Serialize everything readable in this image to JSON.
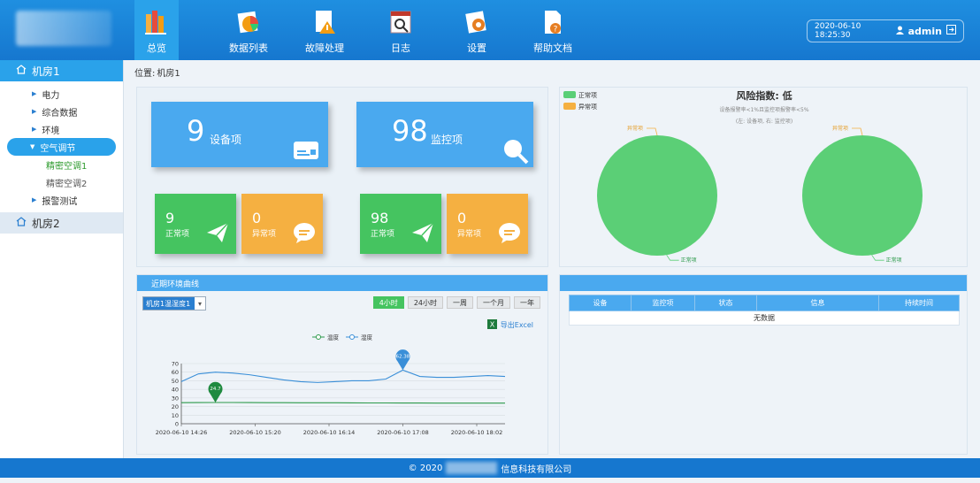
{
  "nav": [
    {
      "label": "总览",
      "icon": "books-icon",
      "active": true
    },
    {
      "label": "数据列表",
      "icon": "pie-chart-icon"
    },
    {
      "label": "故障处理",
      "icon": "warning-icon"
    },
    {
      "label": "日志",
      "icon": "calendar-search-icon"
    },
    {
      "label": "设置",
      "icon": "gear-icon"
    },
    {
      "label": "帮助文档",
      "icon": "help-document-icon"
    }
  ],
  "header": {
    "datetime": "2020-06-10  18:25:30",
    "user": "admin"
  },
  "sidebar": {
    "room1": "机房1",
    "items": [
      "电力",
      "综合数据",
      "环境",
      "空气调节",
      "精密空调1",
      "精密空调2",
      "报警测试"
    ],
    "room2": "机房2"
  },
  "breadcrumb": {
    "label": "位置:",
    "value": "机房1"
  },
  "summary": {
    "device_count": "9",
    "device_label": "设备项",
    "monitor_count": "98",
    "monitor_label": "监控项",
    "device_normal": "9",
    "device_abnormal": "0",
    "monitor_normal": "98",
    "monitor_abnormal": "0",
    "normal_label": "正常项",
    "abnormal_label": "异常项"
  },
  "risk": {
    "title": "风险指数: 低",
    "rule": "设备报警率<1%且监控项报警率<5%",
    "note": "(左: 设备项, 右: 监控项)",
    "legend_normal": "正常项",
    "legend_abnormal": "异常项",
    "normal_color": "#5bcf76",
    "abnormal_color": "#f5b041"
  },
  "trend": {
    "panel_title": "近期环境曲线",
    "select": "机房1温湿度1",
    "ranges": [
      "4小时",
      "24小时",
      "一周",
      "一个月",
      "一年"
    ],
    "export": "导出Excel"
  },
  "alarm_table": {
    "columns": [
      "设备",
      "监控项",
      "状态",
      "信息",
      "持续时间"
    ],
    "empty": "无数据"
  },
  "footer": {
    "copyright": "© 2020",
    "company_suffix": "信息科技有限公司"
  },
  "chart_data": [
    {
      "type": "pie",
      "title": "",
      "labels": [
        "正常项",
        "异常项"
      ],
      "values": [
        9,
        0
      ],
      "colors": [
        "#5bcf76",
        "#f5b041"
      ]
    },
    {
      "type": "pie",
      "title": "",
      "labels": [
        "正常项",
        "异常项"
      ],
      "values": [
        98,
        0
      ],
      "colors": [
        "#5bcf76",
        "#f5b041"
      ]
    },
    {
      "type": "line",
      "title": "",
      "legend": [
        "温度",
        "湿度"
      ],
      "x_ticks": [
        "2020-06-10 14:26",
        "2020-06-10 15:20",
        "2020-06-10 16:14",
        "2020-06-10 17:08",
        "2020-06-10 18:02"
      ],
      "ylim": [
        0,
        70
      ],
      "y_ticks": [
        0,
        10,
        20,
        30,
        40,
        50,
        60,
        70
      ],
      "grid": true,
      "series": [
        {
          "name": "温度",
          "color": "#2c9a4a",
          "values": [
            24.5,
            24.6,
            24.7,
            24.7,
            24.6,
            24.5,
            24.5,
            24.4,
            24.4,
            24.4,
            24.3,
            24.2,
            24.2,
            24.1,
            24.1,
            24.0,
            24.0,
            24.0,
            24.0,
            24.0
          ],
          "marker_label": "24.7"
        },
        {
          "name": "湿度",
          "color": "#3a8fd8",
          "values": [
            49,
            58,
            60,
            59,
            57,
            54,
            51,
            49,
            48,
            49,
            50,
            50,
            52,
            62.38,
            55,
            54,
            54,
            55,
            56,
            55
          ],
          "marker_label": "62.38"
        }
      ]
    }
  ]
}
